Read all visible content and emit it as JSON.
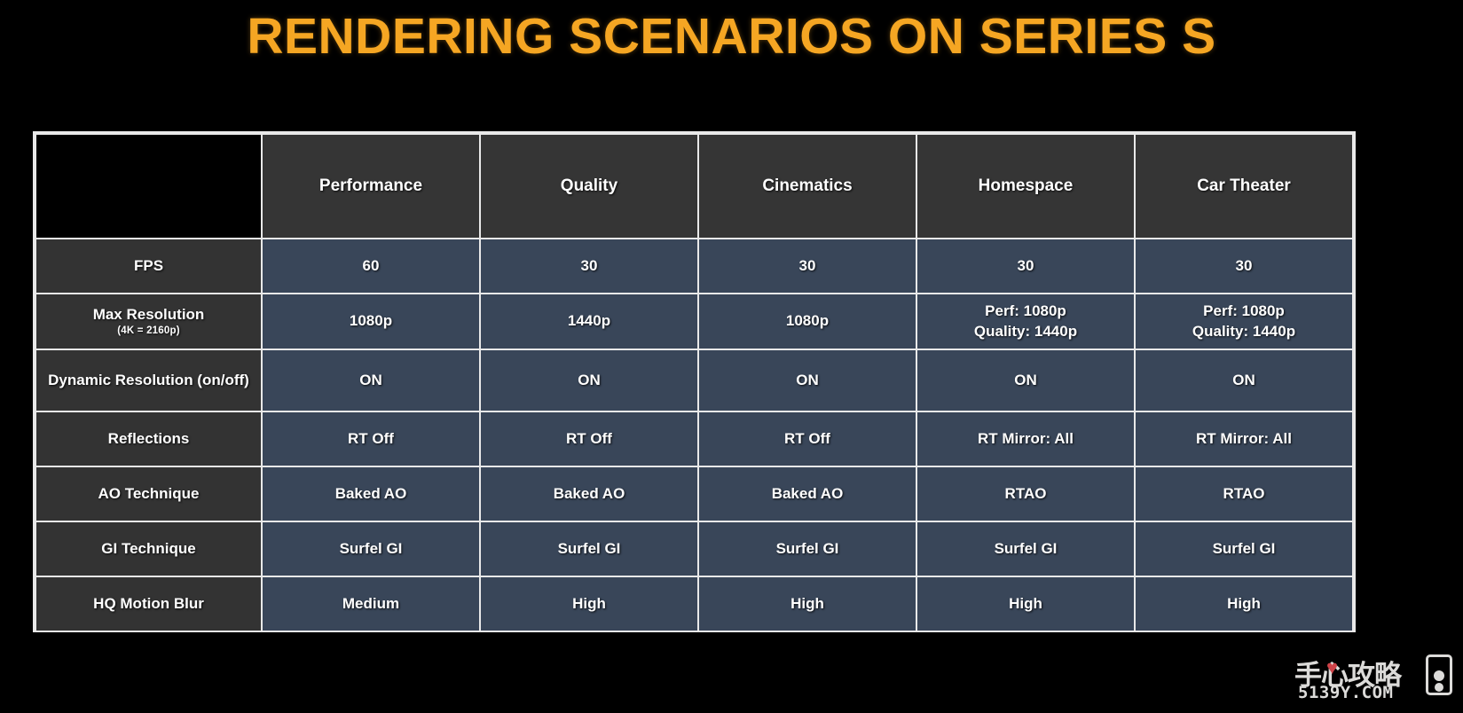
{
  "slide": {
    "title": "RENDERING SCENARIOS ON SERIES S",
    "title_color": "#F5A623",
    "background_color": "#000000"
  },
  "table": {
    "corner_label": "",
    "columns": [
      "Performance",
      "Quality",
      "Cinematics",
      "Homespace",
      "Car Theater"
    ],
    "header_bg": "#353535",
    "cell_bg": "#394659",
    "label_bg": "#333333",
    "border_color": "#E9E9E9",
    "rows": [
      {
        "label": "FPS",
        "sublabel": "",
        "values": [
          {
            "line1": "60",
            "line2": ""
          },
          {
            "line1": "30",
            "line2": ""
          },
          {
            "line1": "30",
            "line2": ""
          },
          {
            "line1": "30",
            "line2": ""
          },
          {
            "line1": "30",
            "line2": ""
          }
        ]
      },
      {
        "label": "Max Resolution",
        "sublabel": "(4K = 2160p)",
        "values": [
          {
            "line1": "1080p",
            "line2": ""
          },
          {
            "line1": "1440p",
            "line2": ""
          },
          {
            "line1": "1080p",
            "line2": ""
          },
          {
            "line1": "Perf: 1080p",
            "line2": "Quality: 1440p"
          },
          {
            "line1": "Perf: 1080p",
            "line2": "Quality: 1440p"
          }
        ]
      },
      {
        "label": "Dynamic Resolution (on/off)",
        "sublabel": "",
        "values": [
          {
            "line1": "ON",
            "line2": ""
          },
          {
            "line1": "ON",
            "line2": ""
          },
          {
            "line1": "ON",
            "line2": ""
          },
          {
            "line1": "ON",
            "line2": ""
          },
          {
            "line1": "ON",
            "line2": ""
          }
        ]
      },
      {
        "label": "Reflections",
        "sublabel": "",
        "values": [
          {
            "line1": "RT Off",
            "line2": ""
          },
          {
            "line1": "RT Off",
            "line2": ""
          },
          {
            "line1": "RT Off",
            "line2": ""
          },
          {
            "line1": "RT Mirror: All",
            "line2": ""
          },
          {
            "line1": "RT Mirror: All",
            "line2": ""
          }
        ]
      },
      {
        "label": "AO Technique",
        "sublabel": "",
        "values": [
          {
            "line1": "Baked AO",
            "line2": ""
          },
          {
            "line1": "Baked AO",
            "line2": ""
          },
          {
            "line1": "Baked AO",
            "line2": ""
          },
          {
            "line1": "RTAO",
            "line2": ""
          },
          {
            "line1": "RTAO",
            "line2": ""
          }
        ]
      },
      {
        "label": "GI Technique",
        "sublabel": "",
        "values": [
          {
            "line1": "Surfel GI",
            "line2": ""
          },
          {
            "line1": "Surfel GI",
            "line2": ""
          },
          {
            "line1": "Surfel GI",
            "line2": ""
          },
          {
            "line1": "Surfel GI",
            "line2": ""
          },
          {
            "line1": "Surfel GI",
            "line2": ""
          }
        ]
      },
      {
        "label": "HQ Motion Blur",
        "sublabel": "",
        "values": [
          {
            "line1": "Medium",
            "line2": ""
          },
          {
            "line1": "High",
            "line2": ""
          },
          {
            "line1": "High",
            "line2": ""
          },
          {
            "line1": "High",
            "line2": ""
          },
          {
            "line1": "High",
            "line2": ""
          }
        ]
      }
    ]
  },
  "watermark": {
    "text_cn": "手心攻略",
    "url": "5139Y.COM",
    "heart": "♥"
  }
}
